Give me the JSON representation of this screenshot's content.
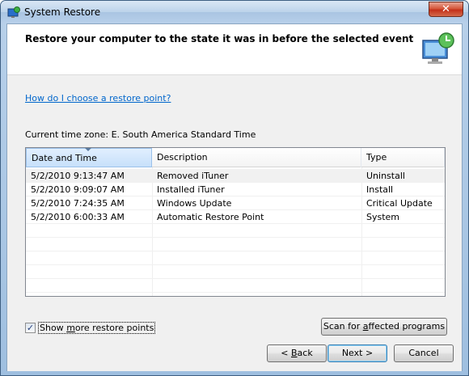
{
  "window": {
    "title": "System Restore",
    "close_glyph": "✕"
  },
  "header": {
    "title": "Restore your computer to the state it was in before the selected event",
    "icon": "system-restore-monitor-icon"
  },
  "help_link": "How do I choose a restore point?",
  "timezone_label": "Current time zone: E. South America Standard Time",
  "table": {
    "columns": [
      "Date and Time",
      "Description",
      "Type"
    ],
    "sorted_column": "Date and Time",
    "rows": [
      {
        "date": "5/2/2010 9:13:47 AM",
        "description": "Removed iTuner",
        "type": "Uninstall"
      },
      {
        "date": "5/2/2010 9:09:07 AM",
        "description": "Installed iTuner",
        "type": "Install"
      },
      {
        "date": "5/2/2010 7:24:35 AM",
        "description": "Windows Update",
        "type": "Critical Update"
      },
      {
        "date": "5/2/2010 6:00:33 AM",
        "description": "Automatic Restore Point",
        "type": "System"
      }
    ]
  },
  "show_more": {
    "label_pre": "Show ",
    "label_access": "m",
    "label_post": "ore restore points",
    "checked": true,
    "check_glyph": "✓"
  },
  "buttons": {
    "scan_pre": "Scan for ",
    "scan_access": "a",
    "scan_post": "ffected programs",
    "back_pre": "< ",
    "back_access": "B",
    "back_post": "ack",
    "next": "Next >",
    "cancel": "Cancel"
  },
  "colors": {
    "link": "#0066cc",
    "title_bar": "#b9d1ea",
    "close_button": "#c3301a"
  }
}
